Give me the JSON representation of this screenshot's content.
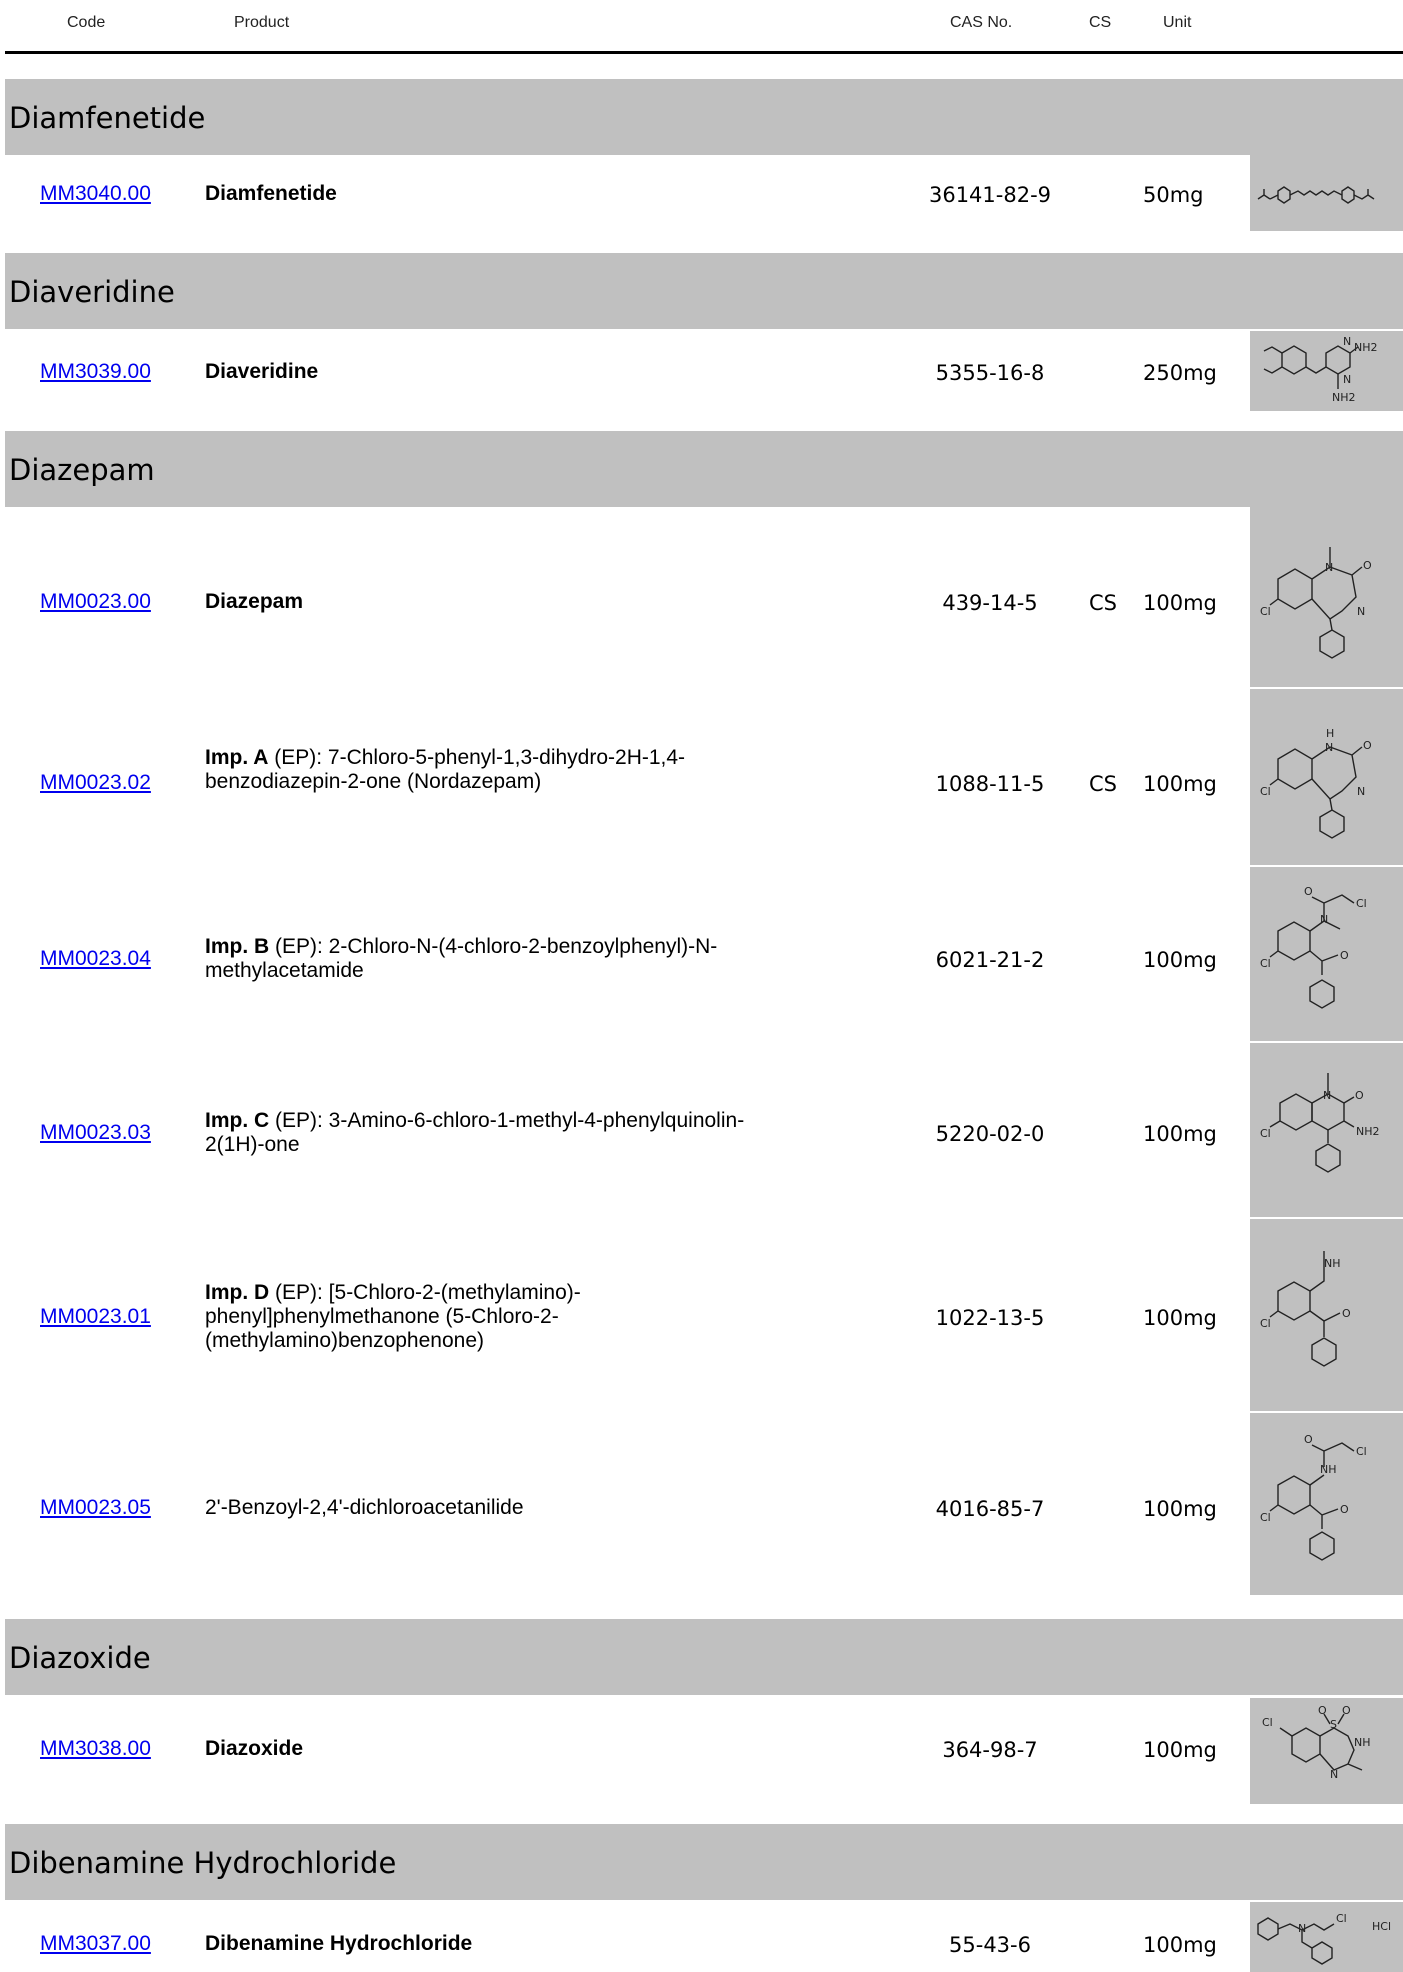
{
  "header": {
    "code": "Code",
    "product": "Product",
    "cas": "CAS No.",
    "cs": "CS",
    "unit": "Unit"
  },
  "sections": [
    {
      "title": "Diamfenetide",
      "rows": [
        {
          "code": "MM3040.00",
          "name_bold": "Diamfenetide",
          "name_rest": "",
          "cas": "36141-82-9",
          "cs": "",
          "unit": "50mg",
          "structure_icon": "diamfenetide-structure-icon"
        }
      ]
    },
    {
      "title": "Diaveridine",
      "rows": [
        {
          "code": "MM3039.00",
          "name_bold": "Diaveridine",
          "name_rest": "",
          "cas": "5355-16-8",
          "cs": "",
          "unit": "250mg",
          "structure_icon": "diaveridine-structure-icon"
        }
      ]
    },
    {
      "title": "Diazepam",
      "rows": [
        {
          "code": "MM0023.00",
          "name_bold": "Diazepam",
          "name_rest": "",
          "cas": "439-14-5",
          "cs": "CS",
          "unit": "100mg",
          "structure_icon": "diazepam-structure-icon"
        },
        {
          "code": "MM0023.02",
          "name_bold": "Imp. A",
          "name_rest": " (EP): 7-Chloro-5-phenyl-1,3-dihydro-2H-1,4-benzodiazepin-2-one (Nordazepam)",
          "cas": "1088-11-5",
          "cs": "CS",
          "unit": "100mg",
          "structure_icon": "nordazepam-structure-icon"
        },
        {
          "code": "MM0023.04",
          "name_bold": "Imp. B",
          "name_rest": " (EP): 2-Chloro-N-(4-chloro-2-benzoylphenyl)-N-methylacetamide",
          "cas": "6021-21-2",
          "cs": "",
          "unit": "100mg",
          "structure_icon": "imp-b-structure-icon"
        },
        {
          "code": "MM0023.03",
          "name_bold": "Imp. C",
          "name_rest": " (EP): 3-Amino-6-chloro-1-methyl-4-phenylquinolin-2(1H)-one",
          "cas": "5220-02-0",
          "cs": "",
          "unit": "100mg",
          "structure_icon": "imp-c-structure-icon"
        },
        {
          "code": "MM0023.01",
          "name_bold": "Imp. D",
          "name_rest": " (EP): [5-Chloro-2-(methylamino)-phenyl]phenylmethanone (5-Chloro-2-(methylamino)benzophenone)",
          "cas": "1022-13-5",
          "cs": "",
          "unit": "100mg",
          "structure_icon": "imp-d-structure-icon"
        },
        {
          "code": "MM0023.05",
          "name_bold": "",
          "name_rest": "2'-Benzoyl-2,4'-dichloroacetanilide",
          "cas": "4016-85-7",
          "cs": "",
          "unit": "100mg",
          "structure_icon": "dichloroacetanilide-structure-icon"
        }
      ]
    },
    {
      "title": "Diazoxide",
      "rows": [
        {
          "code": "MM3038.00",
          "name_bold": "Diazoxide",
          "name_rest": "",
          "cas": "364-98-7",
          "cs": "",
          "unit": "100mg",
          "structure_icon": "diazoxide-structure-icon"
        }
      ]
    },
    {
      "title": "Dibenamine Hydrochloride",
      "rows": [
        {
          "code": "MM3037.00",
          "name_bold": "Dibenamine Hydrochloride",
          "name_rest": "",
          "cas": "55-43-6",
          "cs": "",
          "unit": "100mg",
          "structure_icon": "dibenamine-structure-icon"
        }
      ]
    }
  ],
  "structure_labels": {
    "cl": "Cl",
    "n": "N",
    "o": "O",
    "h": "H",
    "nh": "NH",
    "nh2": "NH2",
    "s": "S",
    "hcl": "HCl"
  }
}
